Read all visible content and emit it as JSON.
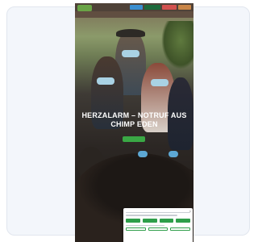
{
  "header": {
    "logo_text": "",
    "topbar_buttons": [
      "",
      "",
      "",
      ""
    ],
    "nav_items": [
      "",
      "",
      "",
      "",
      "",
      ""
    ]
  },
  "hero": {
    "headline_line1": "HERZALARM – NOTRUF AUS",
    "headline_line2": "CHIMP EDEN",
    "cta_label": ""
  },
  "cookie_banner": {
    "title": "",
    "close_glyph": "×",
    "option_labels": [
      "",
      "",
      "",
      ""
    ],
    "button_labels": [
      "",
      "",
      ""
    ]
  },
  "colors": {
    "accent_green": "#3aa845",
    "topbar_blue": "#3b8fd0",
    "topbar_red": "#d2524f",
    "mask_blue": "#a9d2e4"
  }
}
